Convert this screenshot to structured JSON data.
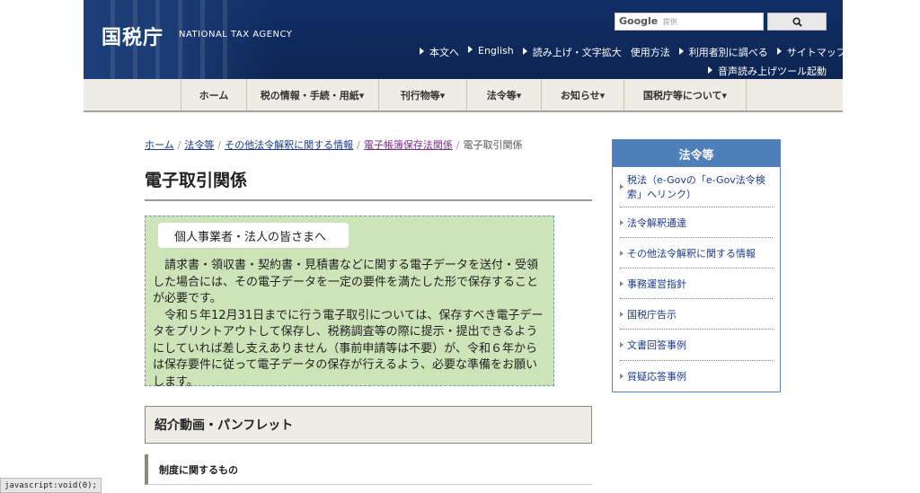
{
  "header": {
    "logo_ja": "国税庁",
    "logo_en": "NATIONAL TAX AGENCY",
    "search": {
      "brand": "Google",
      "placeholder": "提供"
    },
    "util_links": [
      "本文へ",
      "English",
      "読み上げ・文字拡大",
      "使用方法",
      "利用者別に調べる",
      "サイトマップ"
    ],
    "voice_link": "音声読み上げツール起動"
  },
  "gnav": [
    "ホーム",
    "税の情報・手続・用紙▾",
    "刊行物等▾",
    "法令等▾",
    "お知らせ▾",
    "国税庁等について▾"
  ],
  "breadcrumb": {
    "items": [
      "ホーム",
      "法令等",
      "その他法令解釈に関する情報",
      "電子帳簿保存法関係"
    ],
    "current": "電子取引関係",
    "separator": "/"
  },
  "page_title": "電子取引関係",
  "notice": {
    "tag": "個人事業者・法人の皆さまへ",
    "p1": "請求書・領収書・契約書・見積書などに関する電子データを送付・受領した場合には、その電子データを一定の要件を満たした形で保存することが必要です。",
    "p2": "令和５年12月31日までに行う電子取引については、保存すべき電子データをプリントアウトして保存し、税務調査等の際に提示・提出できるようにしていれば差し支えありません（事前申請等は不要）が、令和６年からは保存要件に従って電子データの保存が行えるよう、必要な準備をお願いします。"
  },
  "sections": {
    "videos": "紹介動画・パンフレット",
    "system": "制度に関するもの"
  },
  "sidebar": {
    "title": "法令等",
    "items": [
      "税法（e-Govの「e-Gov法令検索」へリンク）",
      "法令解釈通達",
      "その他法令解釈に関する情報",
      "事務運営指針",
      "国税庁告示",
      "文書回答事例",
      "質疑応答事例"
    ]
  },
  "status_bar": "javascript:void(0);",
  "colors": {
    "header_bg": "#0e2a5c",
    "nav_bg": "#efece6",
    "notice_bg": "#cde3b8",
    "sidebar_head": "#4f7fba"
  }
}
